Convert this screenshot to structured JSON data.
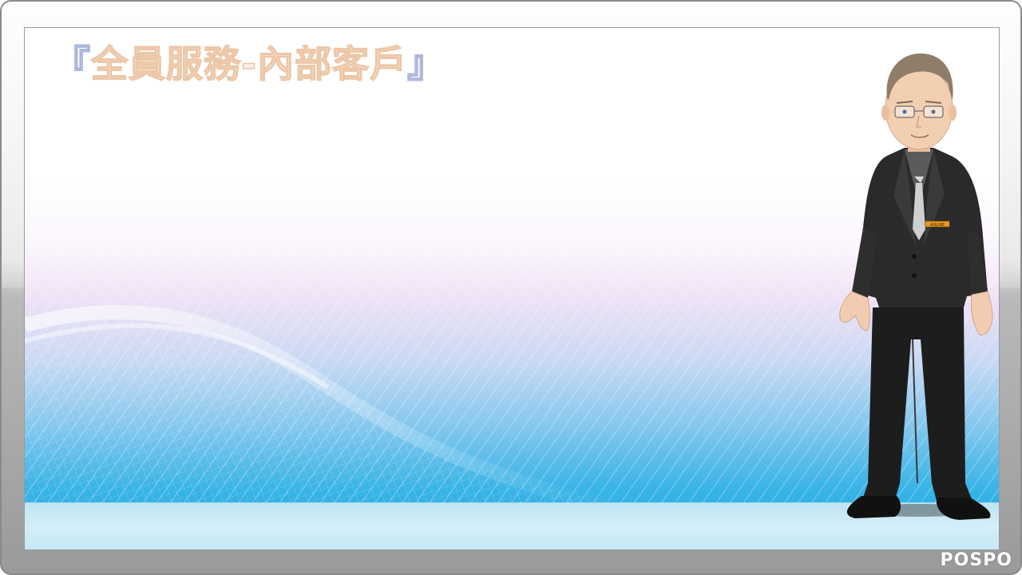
{
  "slide": {
    "title_open": "『",
    "title_text": "全員服務-內部客戶",
    "title_close": "』"
  },
  "character": {
    "name_badge": "ANLINE"
  },
  "watermark": "POSPO",
  "colors": {
    "title_fill": "#fbefe3",
    "title_outline": "#ecc7a8",
    "bracket_outline": "#aeb9dc",
    "sky_blue": "#22aee4",
    "lavender": "#efe2f6",
    "floor": "#c6e8f5",
    "frame_gray": "#9a9a9a"
  }
}
